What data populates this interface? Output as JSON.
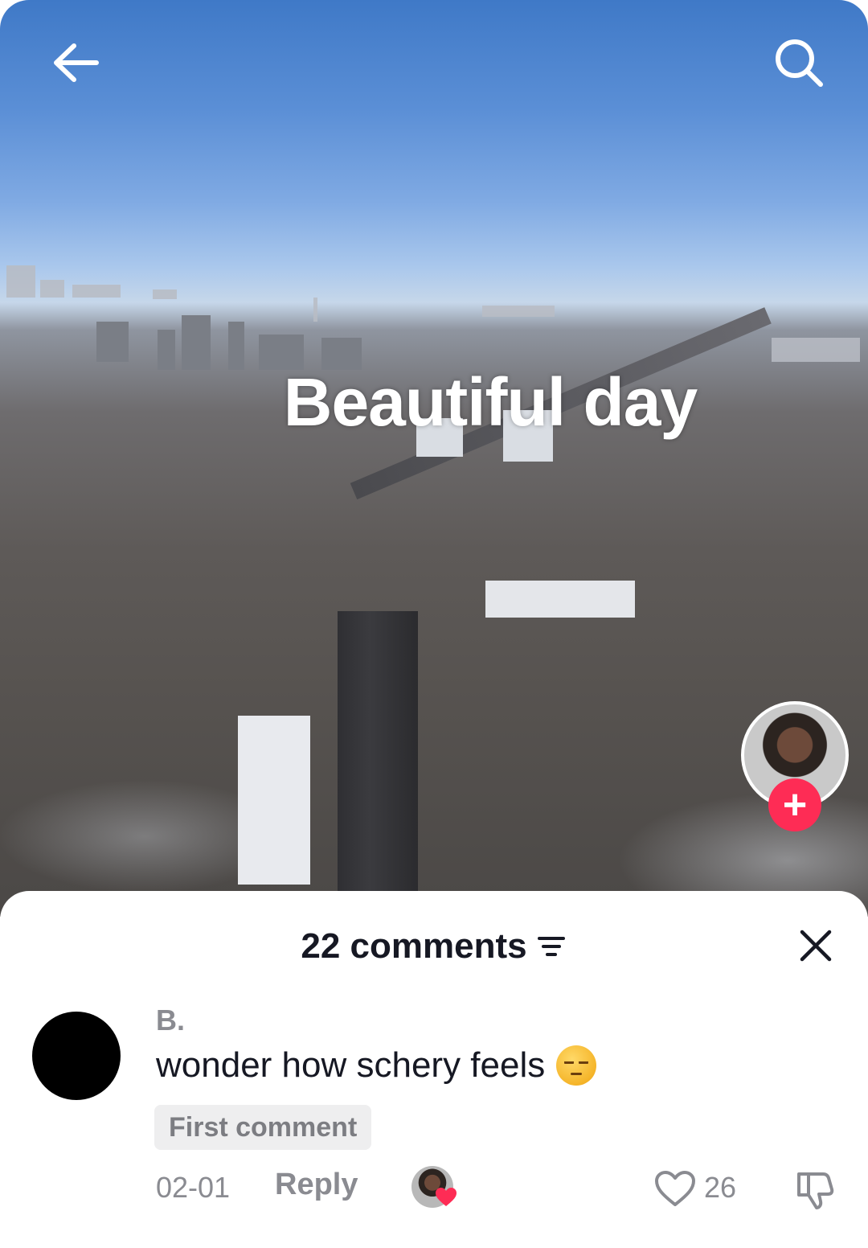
{
  "video": {
    "overlay_text": "Beautiful day"
  },
  "icons": {
    "back": "arrow-left-icon",
    "search": "search-icon",
    "follow": "plus-icon",
    "sort": "filter-lines-icon",
    "close": "close-icon",
    "like": "heart-outline-icon",
    "dislike": "thumbs-down-icon",
    "creator_liked": "heart-filled-icon"
  },
  "creator": {
    "follow_label": "+"
  },
  "comments_sheet": {
    "count_label": "22 comments",
    "comment": {
      "username": "B.",
      "text": "wonder how schery feels",
      "emoji": "pensive-face",
      "badge": "First comment",
      "date": "02-01",
      "reply_label": "Reply",
      "like_count": "26"
    }
  },
  "colors": {
    "follow_accent": "#fe2c55",
    "text_primary": "#161823",
    "text_secondary": "#8a8b91"
  }
}
